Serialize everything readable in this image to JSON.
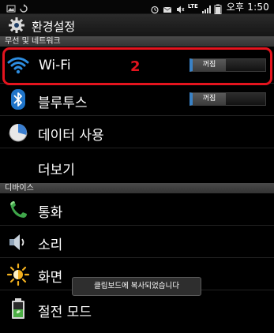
{
  "status_bar": {
    "network_label": "LTE",
    "time": "오후 1:50",
    "icons": [
      "image-icon",
      "sync-icon",
      "alarm-icon",
      "mail-icon",
      "mute-icon",
      "signal-icon",
      "battery-icon"
    ]
  },
  "title_bar": {
    "title": "환경설정",
    "icon": "settings-gear-icon"
  },
  "sections": [
    {
      "header": "무선 및 네트워크",
      "items": [
        {
          "label": "Wi-Fi",
          "icon": "wifi-icon",
          "toggle": "꺼짐"
        },
        {
          "label": "블루투스",
          "icon": "bluetooth-icon",
          "toggle": "꺼짐"
        },
        {
          "label": "데이터 사용",
          "icon": "data-usage-icon"
        },
        {
          "label": "더보기"
        }
      ]
    },
    {
      "header": "디바이스",
      "items": [
        {
          "label": "통화",
          "icon": "phone-icon"
        },
        {
          "label": "소리",
          "icon": "speaker-icon"
        },
        {
          "label": "화면",
          "icon": "brightness-icon"
        },
        {
          "label": "절전 모드",
          "icon": "power-saving-icon"
        }
      ]
    }
  ],
  "annotation": {
    "step_number": "2",
    "highlight_color": "#e4141e"
  },
  "toast": {
    "message": "클립보드에 복사되었습니다"
  },
  "colors": {
    "toggle_accent": "#3a82c6",
    "wifi_blue": "#2d8de0"
  }
}
